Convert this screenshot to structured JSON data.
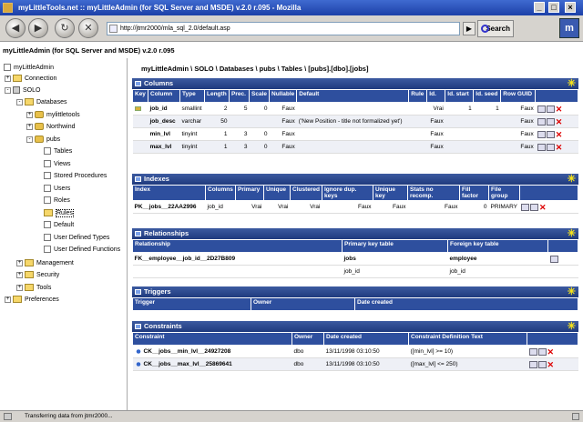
{
  "window": {
    "title": "myLittleTools.net :: myLittleAdmin (for SQL Server and MSDE) v.2.0 r.095 - Mozilla",
    "min": "_",
    "max": "□",
    "close": "×"
  },
  "browser": {
    "url": "http://jtmr2000/mla_sql_2.0/default.asp",
    "search_label": "Search",
    "go_label": "▶",
    "back": "◀",
    "forward": "▶",
    "reload": "↻",
    "stop": "✕",
    "throbber": "m"
  },
  "app": {
    "title": "myLittleAdmin (for SQL Server and MSDE) v.2.0 r.095"
  },
  "tree": {
    "root": "myLittleAdmin",
    "connection": "Connection",
    "server": "SOLO",
    "databases": "Databases",
    "db1": "mylittletools",
    "db2": "Northwind",
    "db3": "pubs",
    "tables": "Tables",
    "views": "Views",
    "procs": "Stored Procedures",
    "users": "Users",
    "roles": "Roles",
    "rules": "Rules",
    "default": "Default",
    "udt": "User Defined Types",
    "udf": "User Defined Functions",
    "management": "Management",
    "security": "Security",
    "tools": "Tools",
    "preferences": "Preferences"
  },
  "breadcrumb": "myLittleAdmin \\ SOLO \\ Databases \\ pubs \\ Tables \\ [pubs].[dbo].[jobs]",
  "columns": {
    "title": "Columns",
    "headers": [
      "Key",
      "Column",
      "Type",
      "Length",
      "Prec.",
      "Scale",
      "Nullable",
      "Default",
      "Rule",
      "Id.",
      "Id. start",
      "Id. seed",
      "Row GUID"
    ],
    "rows": [
      {
        "column": "job_id",
        "type": "smallint",
        "length": "2",
        "prec": "5",
        "scale": "0",
        "nullable": "Faux",
        "default": "",
        "rule": "",
        "id": "Vrai",
        "start": "1",
        "seed": "1",
        "guid": "Faux"
      },
      {
        "column": "job_desc",
        "type": "varchar",
        "length": "50",
        "prec": "",
        "scale": "",
        "nullable": "Faux",
        "default": "('New Position - title not formalized yet')",
        "rule": "",
        "id": "Faux",
        "start": "",
        "seed": "",
        "guid": "Faux"
      },
      {
        "column": "min_lvl",
        "type": "tinyint",
        "length": "1",
        "prec": "3",
        "scale": "0",
        "nullable": "Faux",
        "default": "",
        "rule": "",
        "id": "Faux",
        "start": "",
        "seed": "",
        "guid": "Faux"
      },
      {
        "column": "max_lvl",
        "type": "tinyint",
        "length": "1",
        "prec": "3",
        "scale": "0",
        "nullable": "Faux",
        "default": "",
        "rule": "",
        "id": "Faux",
        "start": "",
        "seed": "",
        "guid": "Faux"
      }
    ]
  },
  "indexes": {
    "title": "Indexes",
    "headers": [
      "Index",
      "Columns",
      "Primary",
      "Unique",
      "Clustered",
      "Ignore dup. keys",
      "Unique key",
      "Stats no recomp.",
      "Fill factor",
      "File group"
    ],
    "rows": [
      {
        "index": "PK__jobs__22AA2996",
        "columns": "job_id",
        "primary": "Vrai",
        "unique": "Vrai",
        "clustered": "Vrai",
        "ignore": "Faux",
        "ukey": "Faux",
        "stats": "Faux",
        "fill": "0",
        "group": "PRIMARY"
      }
    ]
  },
  "relationships": {
    "title": "Relationships",
    "headers": [
      "Relationship",
      "Primary key table",
      "Foreign key table"
    ],
    "rows": [
      {
        "name": "FK__employee__job_id__2D27B809",
        "pk": "jobs",
        "fk": "employee",
        "pkcol": "job_id",
        "fkcol": "job_id"
      }
    ]
  },
  "triggers": {
    "title": "Triggers",
    "headers": [
      "Trigger",
      "Owner",
      "Date created"
    ]
  },
  "constraints": {
    "title": "Constraints",
    "headers": [
      "Constraint",
      "Owner",
      "Date created",
      "Constraint Definition Text"
    ],
    "rows": [
      {
        "name": "CK__jobs__min_lvl__24927208",
        "owner": "dbo",
        "date": "13/11/1998 03:10:50",
        "text": "([min_lvl] >= 10)"
      },
      {
        "name": "CK__jobs__max_lvl__25869641",
        "owner": "dbo",
        "date": "13/11/1998 03:10:50",
        "text": "([max_lvl] <= 250)"
      }
    ]
  },
  "status": "Transferring data from jtmr2000..."
}
